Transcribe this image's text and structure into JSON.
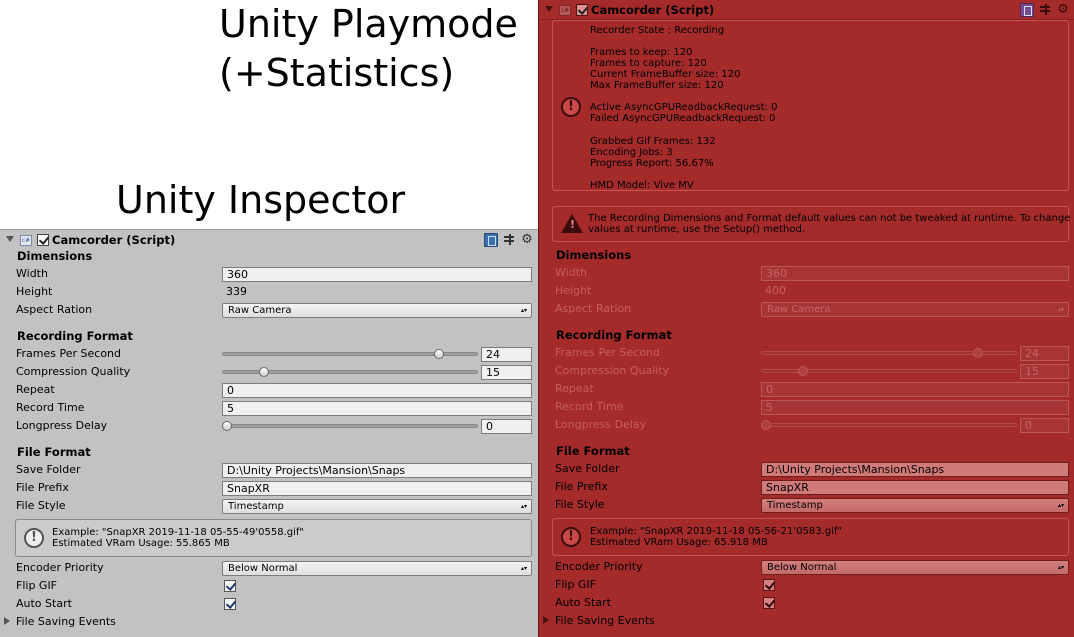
{
  "titles": {
    "playmode_line1": "Unity Playmode",
    "playmode_line2": "(+Statistics)",
    "inspector": "Unity Inspector"
  },
  "component": {
    "script_icon_text": "c#",
    "name": "Camcorder (Script)"
  },
  "stats": {
    "recorder_state": "Recorder State : Recording",
    "frames_to_keep": "Frames to keep: 120",
    "frames_to_capture": "Frames to capture: 120",
    "current_framebuffer": "Current FrameBuffer size: 120",
    "max_framebuffer": "Max FrameBuffer size: 120",
    "active_async": "Active AsyncGPUReadbackRequest: 0",
    "failed_async": "Failed AsyncGPUReadbackRequest: 0",
    "grabbed_gif_frames": "Grabbed Gif Frames: 132",
    "encoding_jobs": "Encoding Jobs: 3",
    "progress_report": "Progress Report: 56.67%",
    "hmd_model": "HMD Model: Vive MV"
  },
  "warning": {
    "line1": "The Recording Dimensions and Format default values can not be tweaked at runtime. To change",
    "line2": "values at runtime, use the Setup() method."
  },
  "labels": {
    "dimensions": "Dimensions",
    "width": "Width",
    "height": "Height",
    "aspect": "Aspect Ration",
    "recording_format": "Recording Format",
    "fps": "Frames Per Second",
    "compression": "Compression Quality",
    "repeat": "Repeat",
    "record_time": "Record Time",
    "longpress": "Longpress Delay",
    "file_format": "File Format",
    "save_folder": "Save Folder",
    "file_prefix": "File Prefix",
    "file_style": "File Style",
    "encoder_priority": "Encoder Priority",
    "flip_gif": "Flip GIF",
    "auto_start": "Auto Start",
    "file_saving_events": "File Saving Events"
  },
  "inspector": {
    "width": "360",
    "height": "339",
    "aspect": "Raw Camera",
    "fps": "24",
    "fps_level": 0.86,
    "compression": "15",
    "compression_level": 0.15,
    "repeat": "0",
    "record_time": "5",
    "longpress": "0",
    "longpress_level": 0.0,
    "save_folder": "D:\\Unity Projects\\Mansion\\Snaps",
    "file_prefix": "SnapXR",
    "file_style": "Timestamp",
    "example": "Example: \"SnapXR 2019-11-18 05-55-49'0558.gif\"",
    "vram": "Estimated VRam Usage: 55.865 MB",
    "encoder_priority": "Below Normal",
    "flip_gif": true,
    "auto_start": true
  },
  "playmode": {
    "width": "360",
    "height": "400",
    "aspect": "Raw Camera",
    "fps": "24",
    "fps_level": 0.86,
    "compression": "15",
    "compression_level": 0.15,
    "repeat": "0",
    "record_time": "5",
    "longpress": "0",
    "longpress_level": 0.0,
    "save_folder": "D:\\Unity Projects\\Mansion\\Snaps",
    "file_prefix": "SnapXR",
    "file_style": "Timestamp",
    "example": "Example: \"SnapXR 2019-11-18 05-56-21'0583.gif\"",
    "vram": "Estimated VRam Usage: 65.918 MB",
    "encoder_priority": "Below Normal",
    "flip_gif": true,
    "auto_start": true
  },
  "colors": {
    "inspector_bg": "#c2c2c2",
    "playmode_tint": "#a52a2a"
  },
  "icons": {
    "foldout": "chevron-down-icon",
    "script": "script-icon",
    "help": "book-icon",
    "preset": "sliders-icon",
    "settings": "gear-icon",
    "info": "info-icon",
    "warning": "warning-icon",
    "collapsed": "chevron-right-icon"
  }
}
